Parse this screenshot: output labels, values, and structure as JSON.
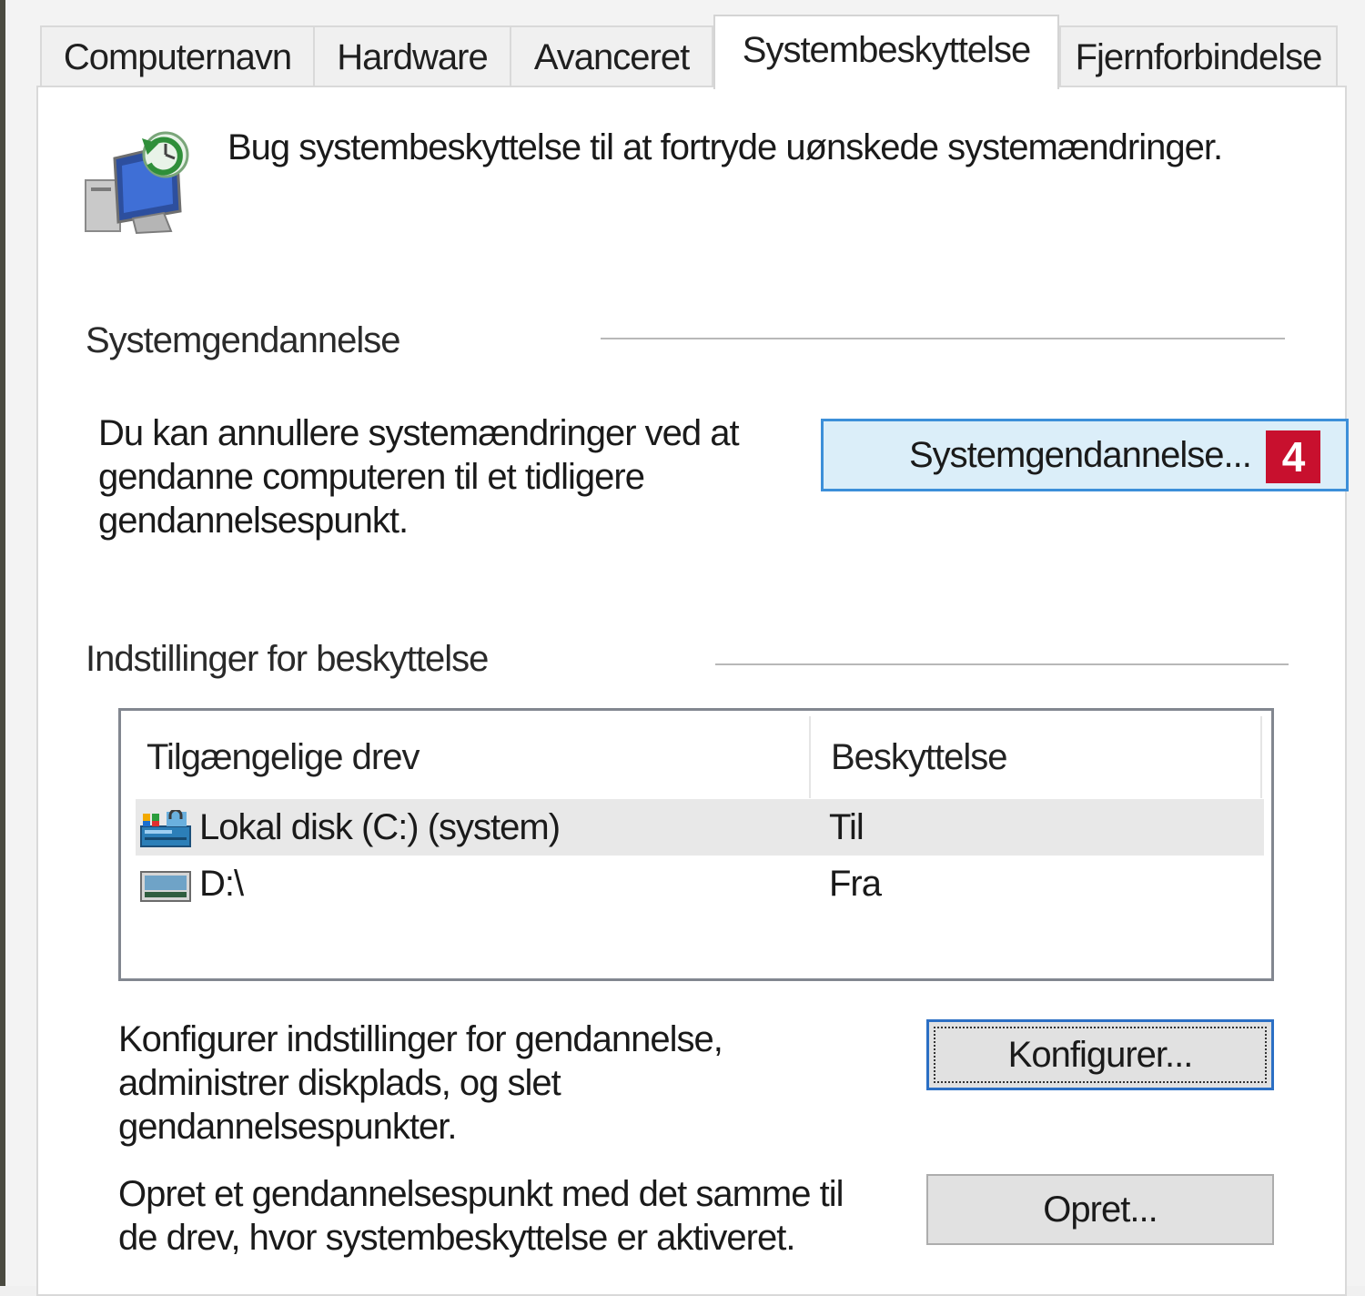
{
  "tabs": [
    {
      "label": "Computernavn",
      "active": false
    },
    {
      "label": "Hardware",
      "active": false
    },
    {
      "label": "Avanceret",
      "active": false
    },
    {
      "label": "Systembeskyttelse",
      "active": true
    },
    {
      "label": "Fjernforbindelse",
      "active": false
    }
  ],
  "intro": {
    "icon": "system-protection-icon",
    "text": "Bug systembeskyttelse til at fortryde uønskede systemændringer."
  },
  "restore_section": {
    "title": "Systemgendannelse",
    "description_lines": [
      "Du kan annullere systemændringer ved at",
      "gendanne computeren til et tidligere",
      "gendannelsespunkt."
    ],
    "button_label": "Systemgendannelse...",
    "badge": "4",
    "badge_color": "#c8102e",
    "button_highlight": "#3c8fd9"
  },
  "protection_section": {
    "title": "Indstillinger for beskyttelse",
    "columns": [
      "Tilgængelige drev",
      "Beskyttelse"
    ],
    "drives": [
      {
        "icon": "system-drive-icon",
        "name": "Lokal disk (C:) (system)",
        "protection": "Til",
        "selected": true
      },
      {
        "icon": "drive-icon",
        "name": "D:\\",
        "protection": "Fra",
        "selected": false
      }
    ],
    "configure_lines": [
      "Konfigurer indstillinger for gendannelse,",
      "administrer diskplads, og slet",
      "gendannelsespunkter."
    ],
    "configure_button": "Konfigurer...",
    "create_lines": [
      "Opret et gendannelsespunkt med det samme til",
      "de drev, hvor systembeskyttelse er aktiveret."
    ],
    "create_button": "Opret..."
  }
}
